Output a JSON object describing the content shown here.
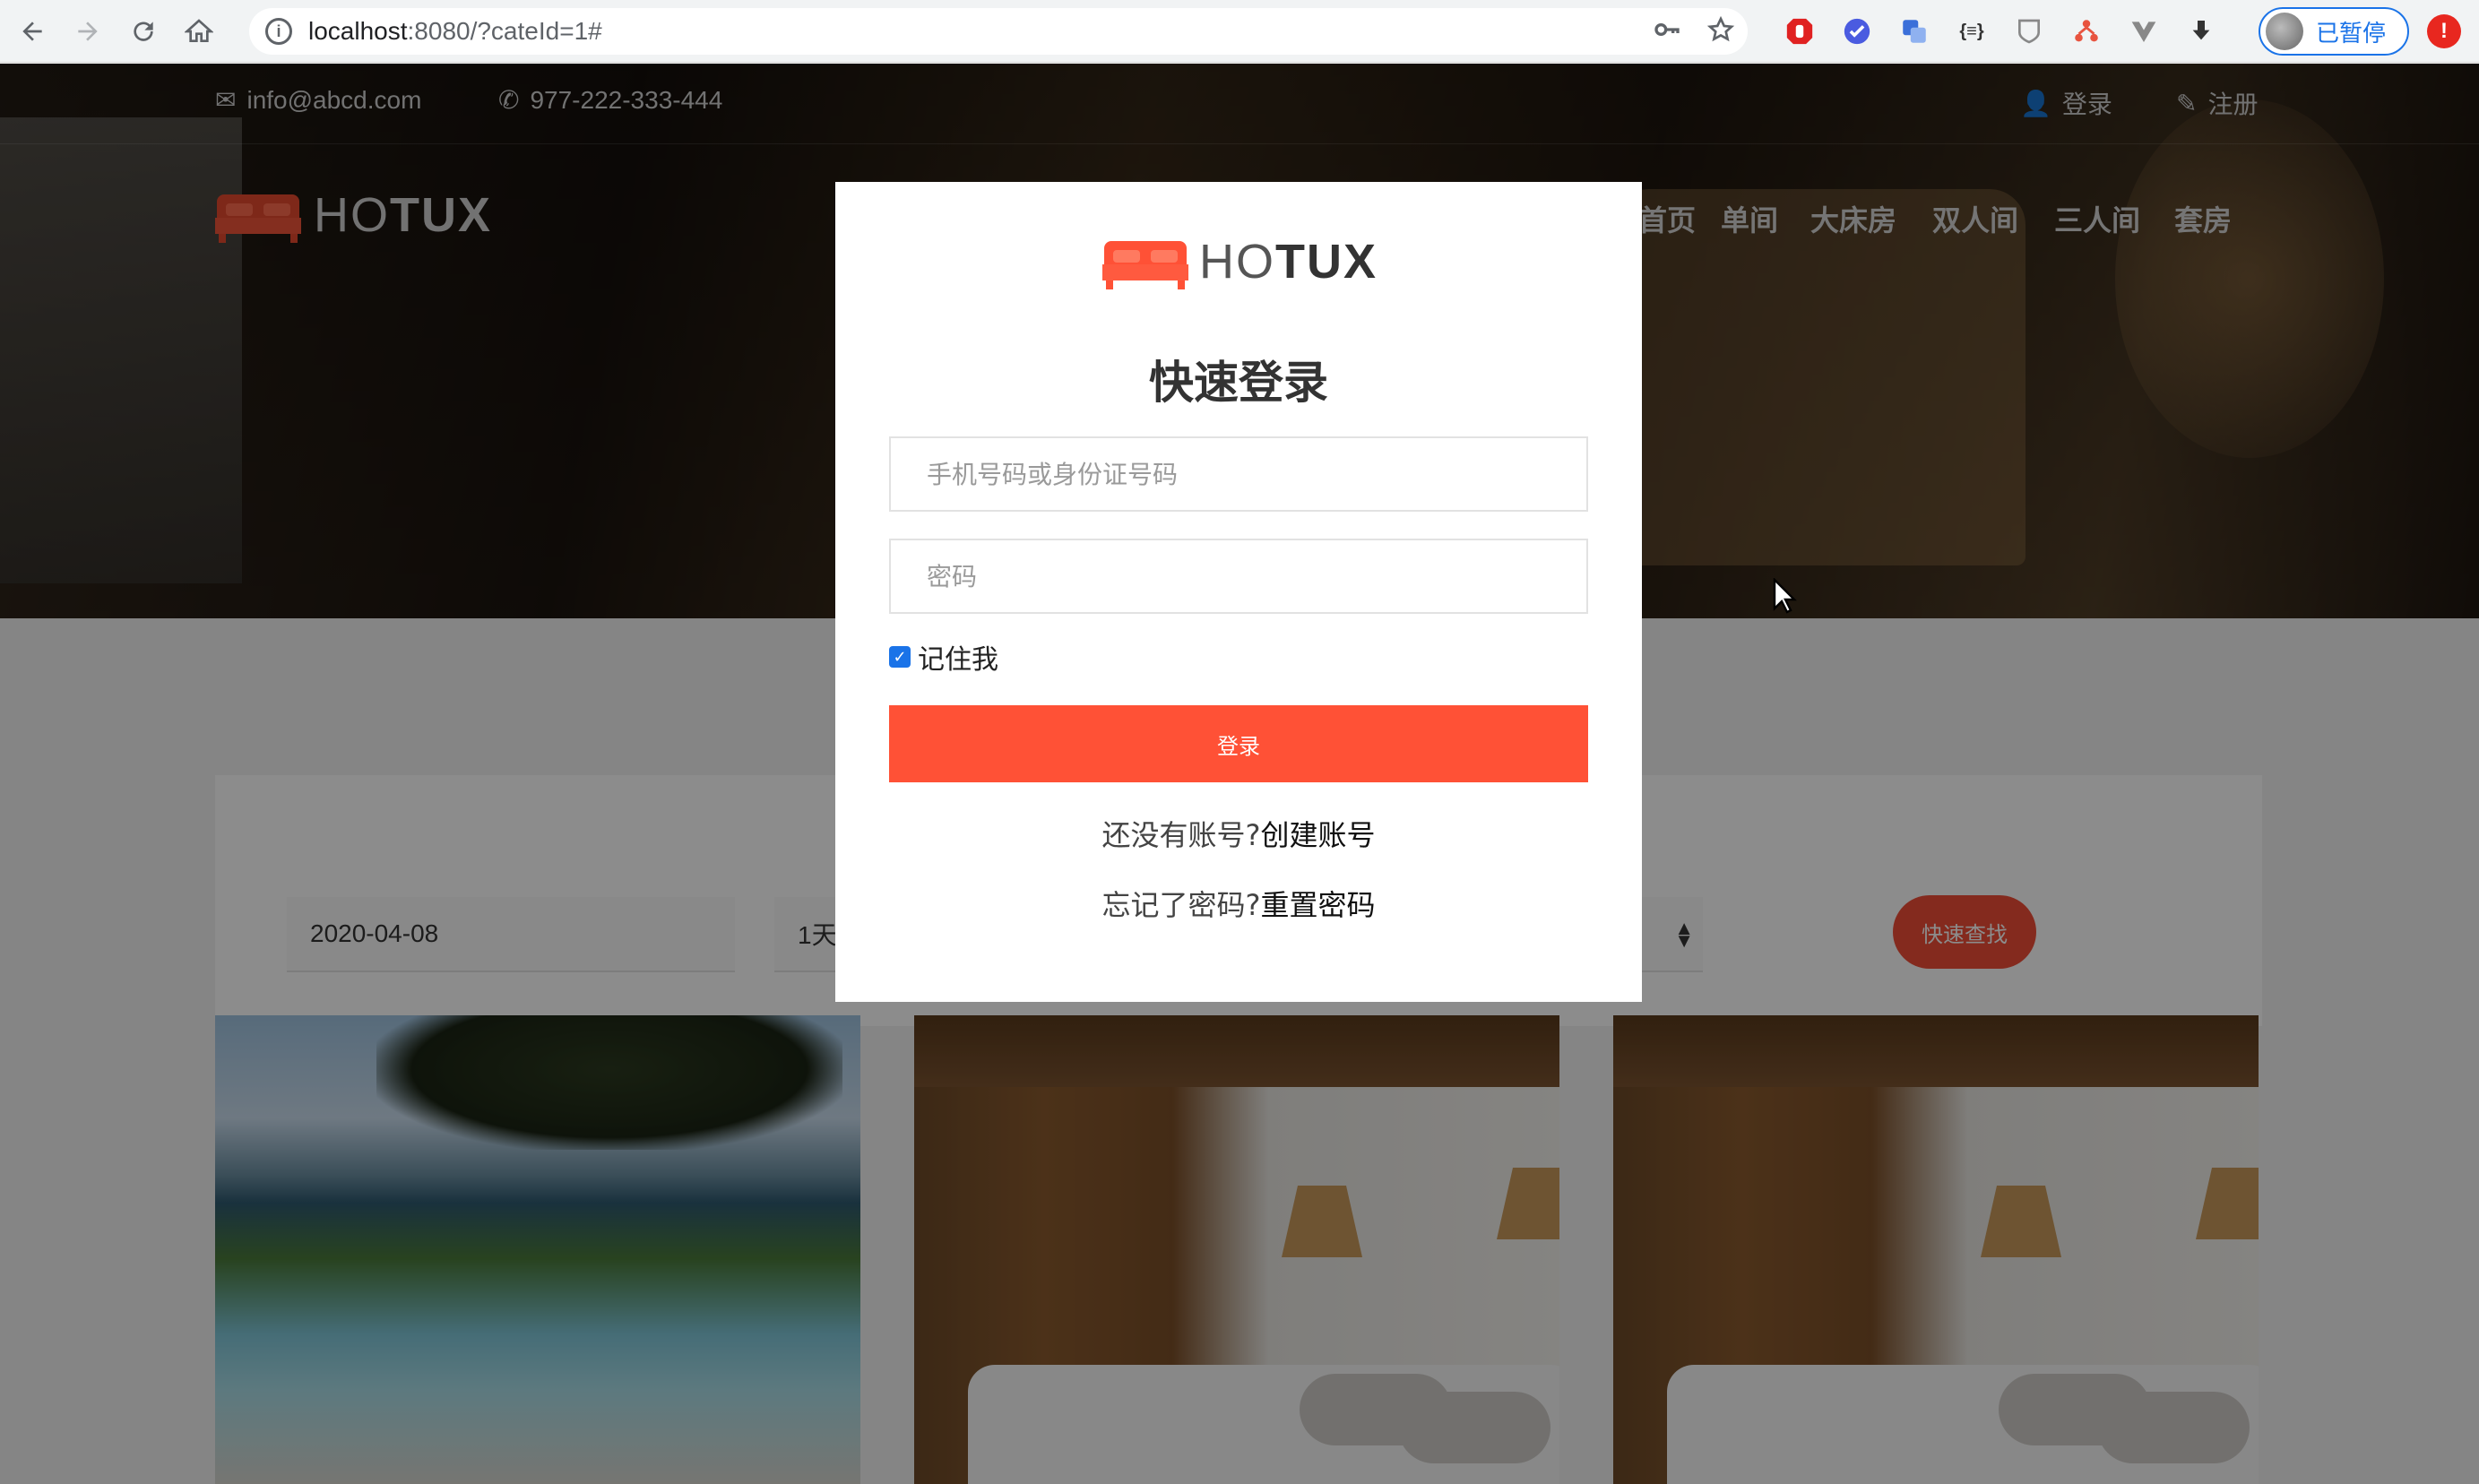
{
  "browser": {
    "url_host": "localhost",
    "url_rest": ":8080/?cateId=1#",
    "profile_label": "已暂停",
    "alert_badge": "!"
  },
  "site": {
    "email": "info@abcd.com",
    "phone": "977-222-333-444",
    "login_link": "登录",
    "register_link": "注册",
    "logo_light": "HO",
    "logo_bold": "TUX",
    "nav": [
      "首页",
      "单间",
      "大床房",
      "双人间",
      "三人间",
      "套房"
    ]
  },
  "search": {
    "date_value": "2020-04-08",
    "days_value": "1天",
    "find_button": "快速查找"
  },
  "modal": {
    "logo_light": "HO",
    "logo_bold": "TUX",
    "title": "快速登录",
    "username_placeholder": "手机号码或身份证号码",
    "password_placeholder": "密码",
    "remember_label": "记住我",
    "remember_checked": true,
    "login_button": "登录",
    "no_account_text": "还没有账号?",
    "create_account_link": "创建账号",
    "forgot_text": "忘记了密码?",
    "reset_link": "重置密码"
  },
  "colors": {
    "accent": "#ff5136",
    "find_button": "#f04e37",
    "checkbox": "#1a73e8"
  }
}
